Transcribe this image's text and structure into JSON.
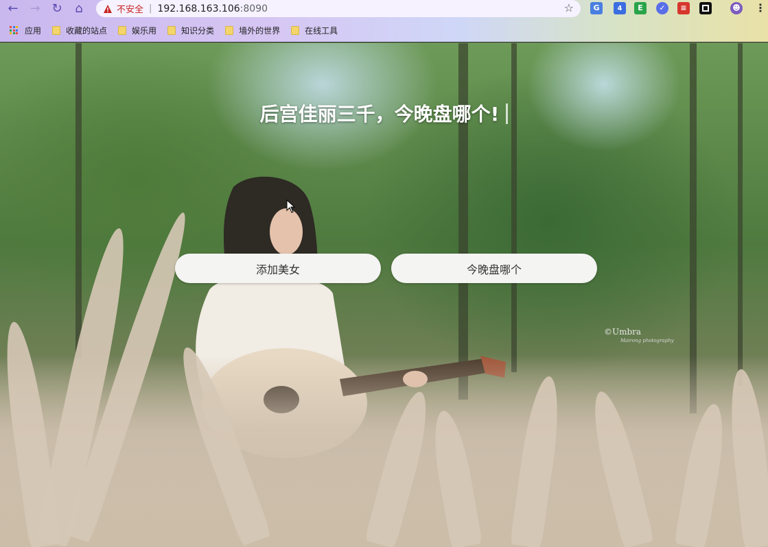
{
  "browser": {
    "address": {
      "security_label": "不安全",
      "host": "192.168.163.106",
      "port": ":8090"
    },
    "extension_badge": "4",
    "bookmarks": [
      {
        "label": "应用",
        "icon": "apps-grid-icon"
      },
      {
        "label": "收藏的站点",
        "icon": "folder-icon"
      },
      {
        "label": "娱乐用",
        "icon": "folder-icon"
      },
      {
        "label": "知识分类",
        "icon": "folder-icon"
      },
      {
        "label": "墙外的世界",
        "icon": "folder-icon"
      },
      {
        "label": "在线工具",
        "icon": "folder-icon"
      }
    ]
  },
  "page": {
    "headline": "后宫佳丽三千，今晚盘哪个!",
    "buttons": {
      "add_label": "添加美女",
      "pick_label": "今晚盘哪个"
    },
    "watermark": "©Umbra",
    "watermark_sub": "Mairong photography"
  },
  "colors": {
    "insecure": "#c5221f",
    "button_bg": "#f4f4f2",
    "headline": "#ffffff"
  }
}
